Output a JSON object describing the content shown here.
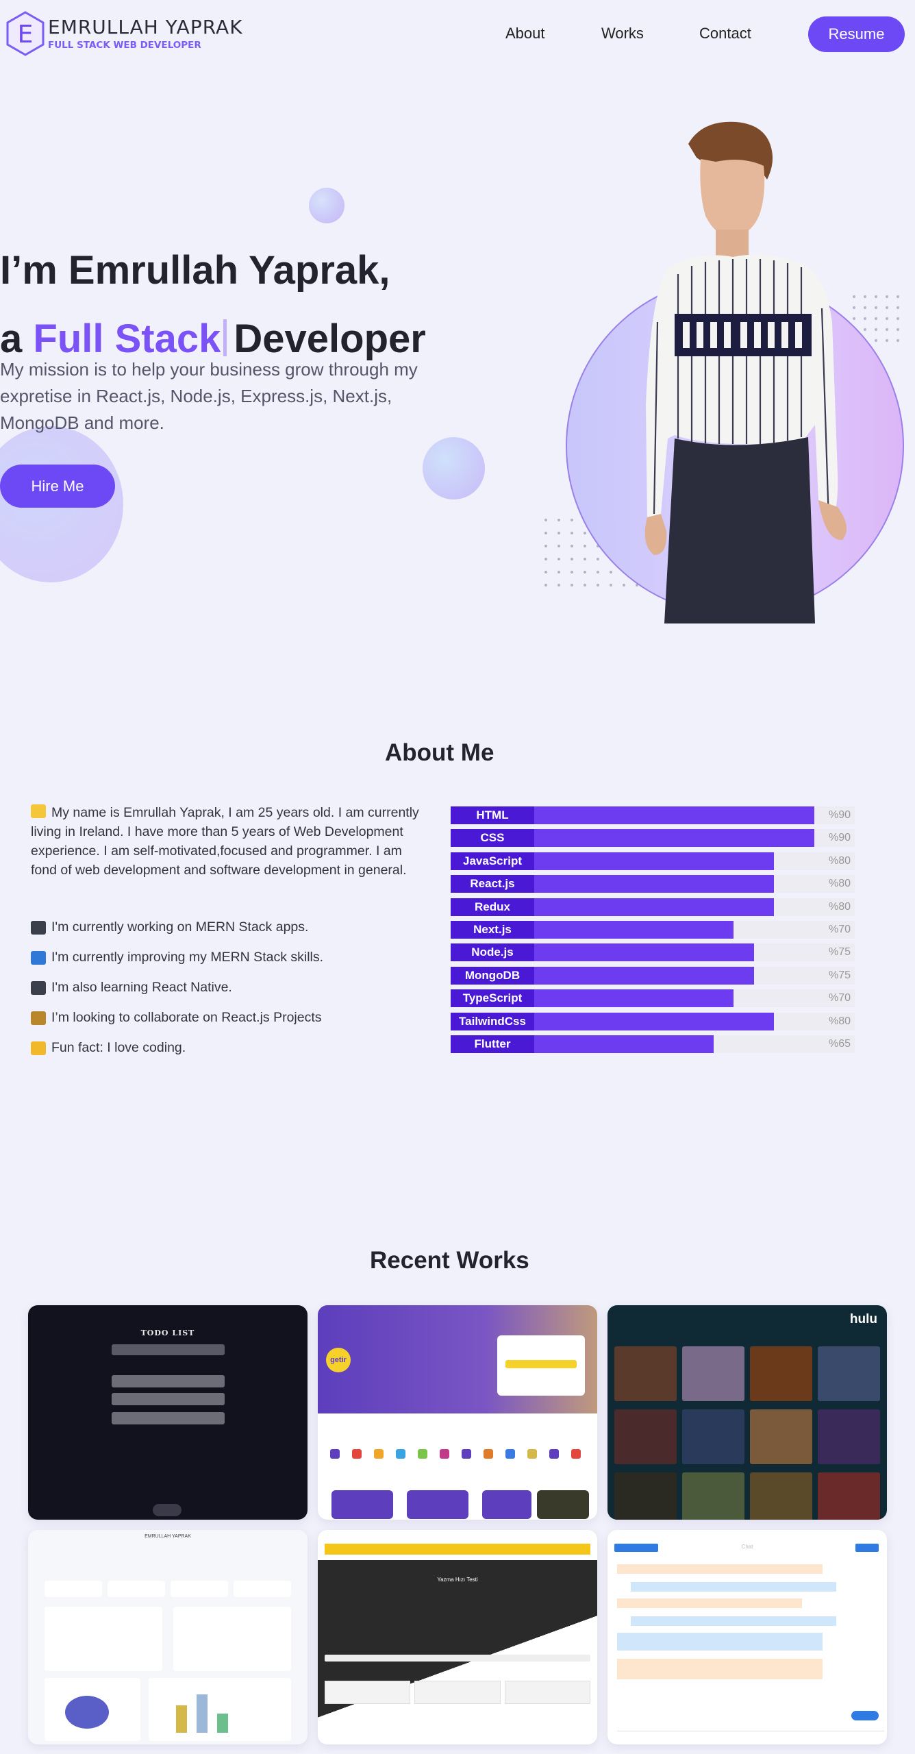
{
  "header": {
    "logo_letter": "E",
    "logo_name": "EMRULLAH YAPRAK",
    "logo_subtitle": "FULL STACK WEB DEVELOPER",
    "nav": [
      {
        "label": "About"
      },
      {
        "label": "Works"
      },
      {
        "label": "Contact"
      }
    ],
    "resume_label": "Resume"
  },
  "hero": {
    "line1": "I’m Emrullah Yaprak,",
    "line2_prefix": "a",
    "line2_accent": "Full Stack",
    "line2_suffix": "Developer",
    "description": "My mission is to help your business grow through my expretise in React.js, Node.js, Express.js, Next.js, MongoDB and more.",
    "hire_label": "Hire Me"
  },
  "about": {
    "title": "About Me",
    "intro": "My name is Emrullah Yaprak, I am 25 years old. I am currently living in Ireland. I have more than 5 years of Web Development experience. I am self-motivated,focused and programmer. I am fond of web development and software development in general.",
    "items": [
      "I'm currently working on MERN Stack apps.",
      "I'm currently improving my MERN Stack skills.",
      "I'm also learning React Native.",
      "I’m looking to collaborate on React.js Projects",
      "Fun fact: I love coding."
    ],
    "skills": [
      {
        "name": "HTML",
        "level": 90,
        "label": "%90"
      },
      {
        "name": "CSS",
        "level": 90,
        "label": "%90"
      },
      {
        "name": "JavaScript",
        "level": 80,
        "label": "%80"
      },
      {
        "name": "React.js",
        "level": 80,
        "label": "%80"
      },
      {
        "name": "Redux",
        "level": 80,
        "label": "%80"
      },
      {
        "name": "Next.js",
        "level": 70,
        "label": "%70"
      },
      {
        "name": "Node.js",
        "level": 75,
        "label": "%75"
      },
      {
        "name": "MongoDB",
        "level": 75,
        "label": "%75"
      },
      {
        "name": "TypeScript",
        "level": 70,
        "label": "%70"
      },
      {
        "name": "TailwindCss",
        "level": 80,
        "label": "%80"
      },
      {
        "name": "Flutter",
        "level": 65,
        "label": "%65"
      }
    ]
  },
  "works": {
    "title": "Recent Works",
    "projects": [
      {
        "title": "TODO LIST"
      },
      {
        "title": "getir"
      },
      {
        "title": "hulu"
      },
      {
        "title": "EMRULLAH YAPRAK"
      },
      {
        "title": "Yazma Hızı Testi"
      },
      {
        "title": "Chat"
      }
    ]
  },
  "colors": {
    "accent": "#6c49f5",
    "skill_fill": "#6e3cf0",
    "skill_label": "#4a19d6",
    "background": "#f1f1fb"
  }
}
